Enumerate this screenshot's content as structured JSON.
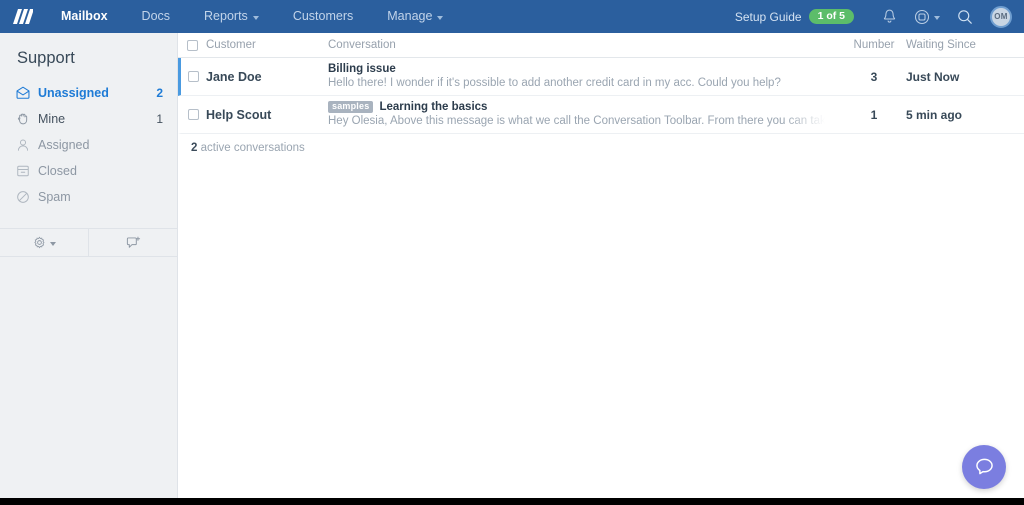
{
  "header": {
    "logo_name": "helpscout-logo",
    "nav": [
      {
        "label": "Mailbox",
        "active": true,
        "has_caret": false
      },
      {
        "label": "Docs",
        "active": false,
        "has_caret": false
      },
      {
        "label": "Reports",
        "active": false,
        "has_caret": true
      },
      {
        "label": "Customers",
        "active": false,
        "has_caret": false
      },
      {
        "label": "Manage",
        "active": false,
        "has_caret": true
      }
    ],
    "setup_guide_label": "Setup Guide",
    "setup_guide_badge": "1 of 5",
    "avatar_initials": "OM",
    "accent_blue": "#2b5f9e",
    "badge_green": "#5cbd6a"
  },
  "sidebar": {
    "title": "Support",
    "folders": [
      {
        "label": "Unassigned",
        "count": "2",
        "icon": "inbox-icon",
        "state": "active"
      },
      {
        "label": "Mine",
        "count": "1",
        "icon": "hand-icon",
        "state": "strong"
      },
      {
        "label": "Assigned",
        "count": "",
        "icon": "person-icon",
        "state": "muted"
      },
      {
        "label": "Closed",
        "count": "",
        "icon": "archive-icon",
        "state": "muted"
      },
      {
        "label": "Spam",
        "count": "",
        "icon": "ban-icon",
        "state": "muted"
      }
    ],
    "tools": [
      {
        "name": "mailbox-settings-button",
        "icon": "gear-icon",
        "caret": true
      },
      {
        "name": "new-conversation-button",
        "icon": "chat-plus-icon",
        "caret": false
      }
    ]
  },
  "list": {
    "columns": {
      "customer": "Customer",
      "conversation": "Conversation",
      "number": "Number",
      "waiting_since": "Waiting Since"
    },
    "rows": [
      {
        "customer": "Jane Doe",
        "tag": "",
        "subject": "Billing issue",
        "preview": "Hello there! I wonder if it's possible to add another credit card in my acc. Could you help?",
        "number": "3",
        "waiting_since": "Just Now",
        "unread": true
      },
      {
        "customer": "Help Scout",
        "tag": "samples",
        "subject": "Learning the basics",
        "preview": "Hey Olesia, Above this message is what we call the Conversation Toolbar. From there you can take all sorts of actions on",
        "number": "1",
        "waiting_since": "5 min ago",
        "unread": false
      }
    ],
    "footer_count": "2",
    "footer_text": " active conversations"
  },
  "beacon": {
    "name": "help-beacon-button",
    "color": "#7b7ee0",
    "icon": "chat-bubble-icon"
  }
}
